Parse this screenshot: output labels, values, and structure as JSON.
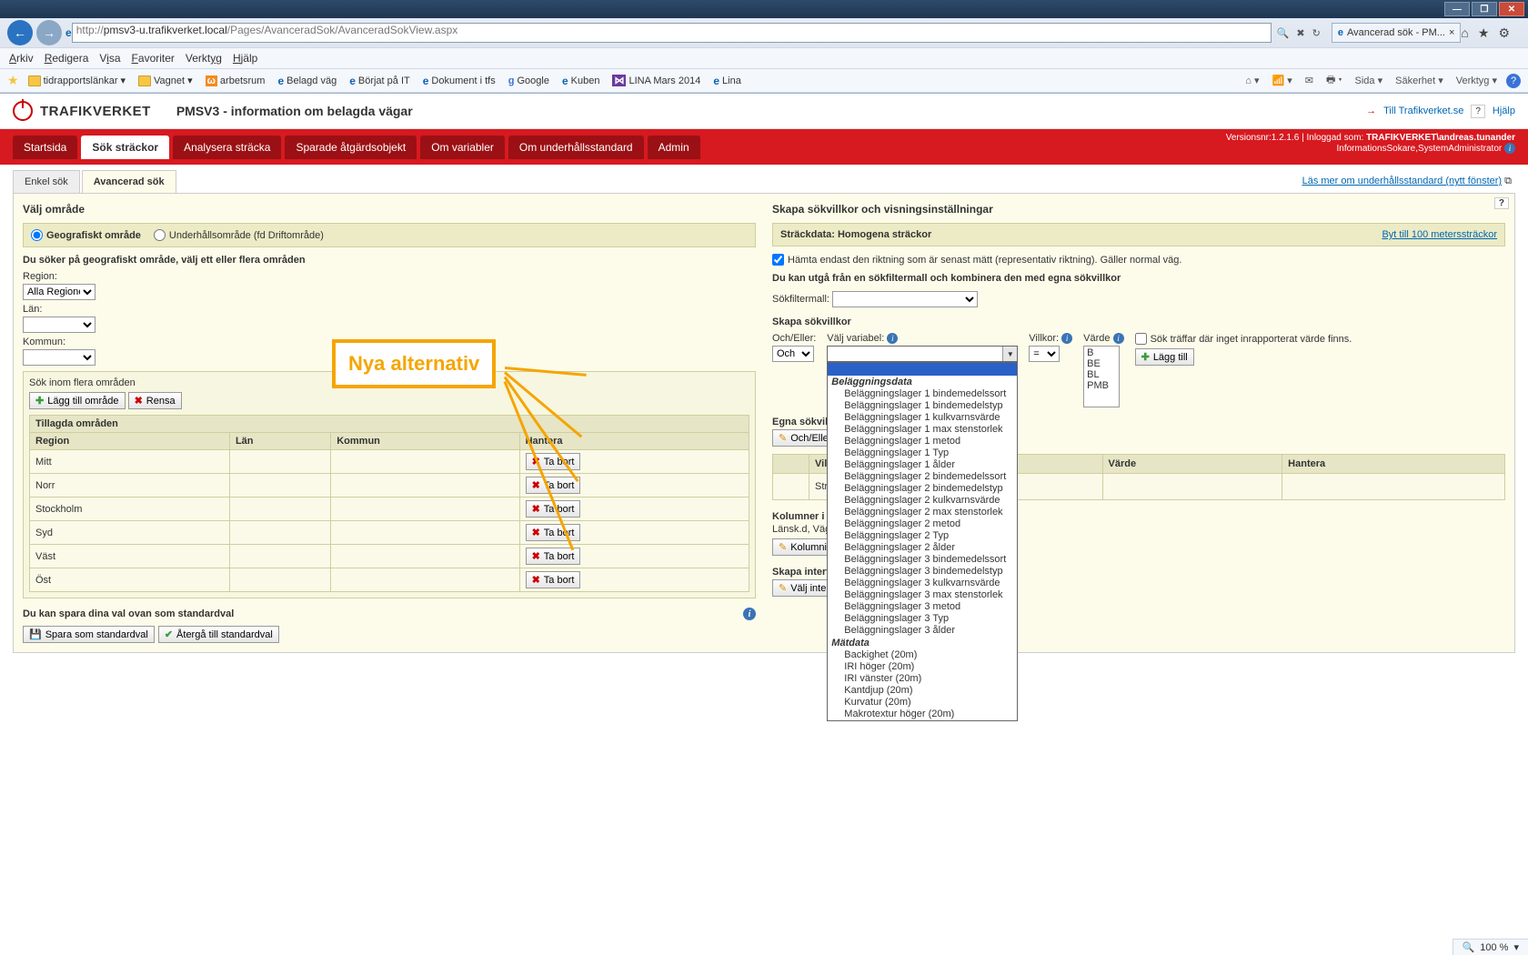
{
  "browser": {
    "url_prefix": "http://",
    "url_host": "pmsv3-u.trafikverket.local",
    "url_path": "/Pages/AvanceradSok/AvanceradSokView.aspx",
    "tab_title": "Avancerad sök - PM...",
    "menu": [
      "Arkiv",
      "Redigera",
      "Visa",
      "Favoriter",
      "Verktyg",
      "Hjälp"
    ],
    "fav": [
      "tidrapportslänkar",
      "Vagnet",
      "arbetsrum",
      "Belagd väg",
      "Börjat på IT",
      "Dokument i tfs",
      "Google",
      "Kuben",
      "LINA Mars 2014",
      "Lina"
    ],
    "favtools": [
      "Sida",
      "Säkerhet",
      "Verktyg"
    ],
    "zoom": "100 %"
  },
  "header": {
    "brand": "TRAFIKVERKET",
    "subtitle": "PMSV3 - information om belagda vägar",
    "link": "Till Trafikverket.se",
    "help": "Hjälp",
    "version": "Versionsnr:1.2.1.6 | Inloggad som:",
    "user": "TRAFIKVERKET\\andreas.tunander",
    "roles": "InformationsSokare,SystemAdministrator"
  },
  "navtabs": [
    "Startsida",
    "Sök sträckor",
    "Analysera sträcka",
    "Sparade åtgärdsobjekt",
    "Om variabler",
    "Om underhållsstandard",
    "Admin"
  ],
  "navtab_active": 1,
  "subtabs": {
    "items": [
      "Enkel sök",
      "Avancerad sök"
    ],
    "active": 1,
    "right_link": "Läs mer om underhållsstandard (nytt fönster)"
  },
  "left": {
    "heading": "Välj område",
    "radio_geo": "Geografiskt område",
    "radio_under": "Underhållsområde (fd Driftområde)",
    "intro": "Du söker på geografiskt område, välj ett eller flera områden",
    "region_lbl": "Region:",
    "region_val": "Alla Regioner",
    "lan_lbl": "Län:",
    "kommun_lbl": "Kommun:",
    "multi_title": "Sök inom flera områden",
    "btn_add": "Lägg till område",
    "btn_clear": "Rensa",
    "table_title": "Tillagda områden",
    "cols": {
      "region": "Region",
      "lan": "Län",
      "kommun": "Kommun",
      "hantera": "Hantera"
    },
    "btn_remove": "Ta bort",
    "rows": [
      "Mitt",
      "Norr",
      "Stockholm",
      "Syd",
      "Väst",
      "Öst"
    ],
    "save_title": "Du kan spara dina val ovan som standardval",
    "btn_save_std": "Spara som standardval",
    "btn_reset_std": "Återgå till standardval"
  },
  "right": {
    "heading": "Skapa sökvillkor och visningsinställningar",
    "panel_title": "Sträckdata: Homogena sträckor",
    "panel_link": "Byt till 100 meterssträckor",
    "chk_hamta": "Hämta endast den riktning som är senast mätt (representativ riktning). Gäller normal väg.",
    "filter_intro": "Du kan utgå från en sökfiltermall och kombinera den med egna sökvillkor",
    "filter_lbl": "Sökfiltermall:",
    "skapa_title": "Skapa sökvillkor",
    "ocheller_lbl": "Och/Eller:",
    "ocheller_val": "Och",
    "variabel_lbl": "Välj variabel:",
    "villkor_lbl": "Villkor:",
    "villkor_val": "=",
    "varde_lbl": "Värde",
    "varde_opts": [
      "B",
      "BE",
      "BL",
      "PMB"
    ],
    "chk_notreported": "Sök träffar där inget inrapporterat värde finns.",
    "btn_laggtill": "Lägg till",
    "egna_title": "Egna sökvillkor",
    "btn_ocheller": "Och/Eller",
    "kol_title": "Kolumner i resultat",
    "kol_text": "Länsk.d, Väg...",
    "btn_kol": "Kolumninställning",
    "interval_title": "Skapa intervall",
    "btn_interval": "Välj intervall",
    "table_cols": {
      "villkor": "Villkor",
      "varde": "Värde",
      "hantera": "Hantera"
    },
    "table_row": "Sträcklängd",
    "dropdown_groups": [
      {
        "name": "Beläggningsdata",
        "items": [
          "Beläggningslager 1 bindemedelssort",
          "Beläggningslager 1 bindemedelstyp",
          "Beläggningslager 1 kulkvarnsvärde",
          "Beläggningslager 1 max stenstorlek",
          "Beläggningslager 1 metod",
          "Beläggningslager 1 Typ",
          "Beläggningslager 1 ålder",
          "Beläggningslager 2 bindemedelssort",
          "Beläggningslager 2 bindemedelstyp",
          "Beläggningslager 2 kulkvarnsvärde",
          "Beläggningslager 2 max stenstorlek",
          "Beläggningslager 2 metod",
          "Beläggningslager 2 Typ",
          "Beläggningslager 2 ålder",
          "Beläggningslager 3 bindemedelssort",
          "Beläggningslager 3 bindemedelstyp",
          "Beläggningslager 3 kulkvarnsvärde",
          "Beläggningslager 3 max stenstorlek",
          "Beläggningslager 3 metod",
          "Beläggningslager 3 Typ",
          "Beläggningslager 3 ålder"
        ]
      },
      {
        "name": "Mätdata",
        "items": [
          "Backighet (20m)",
          "IRI höger (20m)",
          "IRI vänster (20m)",
          "Kantdjup (20m)",
          "Kurvatur (20m)",
          "Makrotextur höger (20m)"
        ]
      }
    ]
  },
  "callout": "Nya alternativ"
}
